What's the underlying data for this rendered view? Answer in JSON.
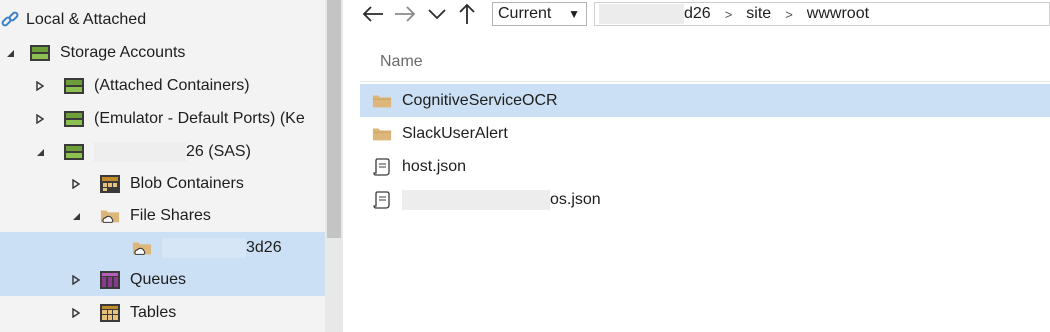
{
  "tree": {
    "items": [
      {
        "label": "Local & Attached",
        "blurred_prefix": "",
        "icon": "link-icon",
        "expander": "none"
      },
      {
        "label": "Storage Accounts",
        "blurred_prefix": "",
        "icon": "storage-icon",
        "expander": "expanded"
      },
      {
        "label": "(Attached Containers)",
        "blurred_prefix": "",
        "icon": "storage-icon",
        "expander": "collapsed"
      },
      {
        "label": "(Emulator - Default Ports) (Ke",
        "blurred_prefix": "",
        "icon": "storage-icon",
        "expander": "collapsed"
      },
      {
        "label": "26 (SAS)",
        "blurred_prefix": "redacted",
        "icon": "storage-icon",
        "expander": "expanded"
      },
      {
        "label": "Blob Containers",
        "blurred_prefix": "",
        "icon": "blob-icon",
        "expander": "collapsed"
      },
      {
        "label": "File Shares",
        "blurred_prefix": "",
        "icon": "folder-cloud-icon",
        "expander": "expanded"
      },
      {
        "label": "3d26",
        "blurred_prefix": "redacted",
        "icon": "folder-cloud-icon",
        "expander": "none"
      },
      {
        "label": "Queues",
        "blurred_prefix": "",
        "icon": "queue-icon",
        "expander": "collapsed"
      },
      {
        "label": "Tables",
        "blurred_prefix": "",
        "icon": "table-icon",
        "expander": "collapsed"
      }
    ]
  },
  "toolbar": {
    "view_selected": "Current",
    "breadcrumb": [
      "d26",
      "site",
      "wwwroot"
    ]
  },
  "list": {
    "header_name": "Name",
    "items": [
      {
        "name": "CognitiveServiceOCR",
        "type": "folder",
        "selected": true
      },
      {
        "name": "SlackUserAlert",
        "type": "folder",
        "selected": false
      },
      {
        "name": "host.json",
        "type": "file",
        "selected": false
      },
      {
        "name": "os.json",
        "type": "file",
        "selected": false
      }
    ]
  },
  "colors": {
    "selection": "#cce0f5",
    "folder": "#dcb67a",
    "storage_green": "#6c9e3a",
    "link_blue": "#3c7fc4",
    "queue_purple": "#8a3a8c"
  }
}
